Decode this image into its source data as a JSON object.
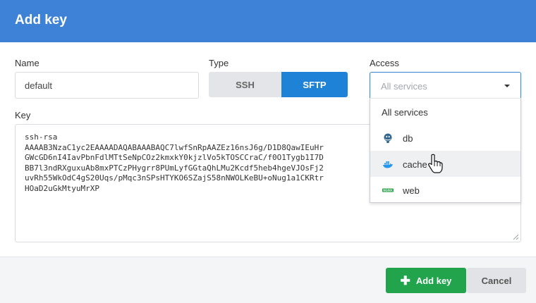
{
  "dialog": {
    "title": "Add key"
  },
  "form": {
    "name": {
      "label": "Name",
      "value": "default"
    },
    "type": {
      "label": "Type",
      "options": [
        "SSH",
        "SFTP"
      ],
      "selected": "SFTP"
    },
    "access": {
      "label": "Access",
      "placeholder": "All services",
      "menu": [
        {
          "label": "All services",
          "icon": ""
        },
        {
          "label": "db",
          "icon": "postgresql-icon"
        },
        {
          "label": "cache",
          "icon": "docker-whale-icon"
        },
        {
          "label": "web",
          "icon": "nginx-icon"
        }
      ],
      "hovered": "cache"
    },
    "key": {
      "label": "Key",
      "lines": [
        "ssh-rsa",
        "AAAAB3NzaC1yc2EAAAADAQABAAABAQC7lwfSnRpAAZEz16nsJ6g/D1D8QawIEuHr",
        "GWcGD6nI4IavPbnFdlMTtSeNpCOz2kmxkY0kjzlVo5kTOSCCraC/f0O1Tygb1I7D",
        "BB7l3ndRXguxuAb8mxPTCzPHygrr8PUmLyfGGtaQhLMu2Kcdf5heb4hgeVJOsFj2",
        "uvRh55WkOdC4gS20Uqs/pMqc3nSPsHTYKO6SZajS58nNWOLKeBU+oNug1a1CKRtr",
        "HOaD2uGkMtyuMrXP"
      ]
    }
  },
  "footer": {
    "add_label": "Add key",
    "cancel_label": "Cancel"
  },
  "colors": {
    "header": "#3d82d7",
    "sftp_active": "#1e82d6",
    "add_button": "#21a44c",
    "cancel_button": "#e1e3e6"
  }
}
